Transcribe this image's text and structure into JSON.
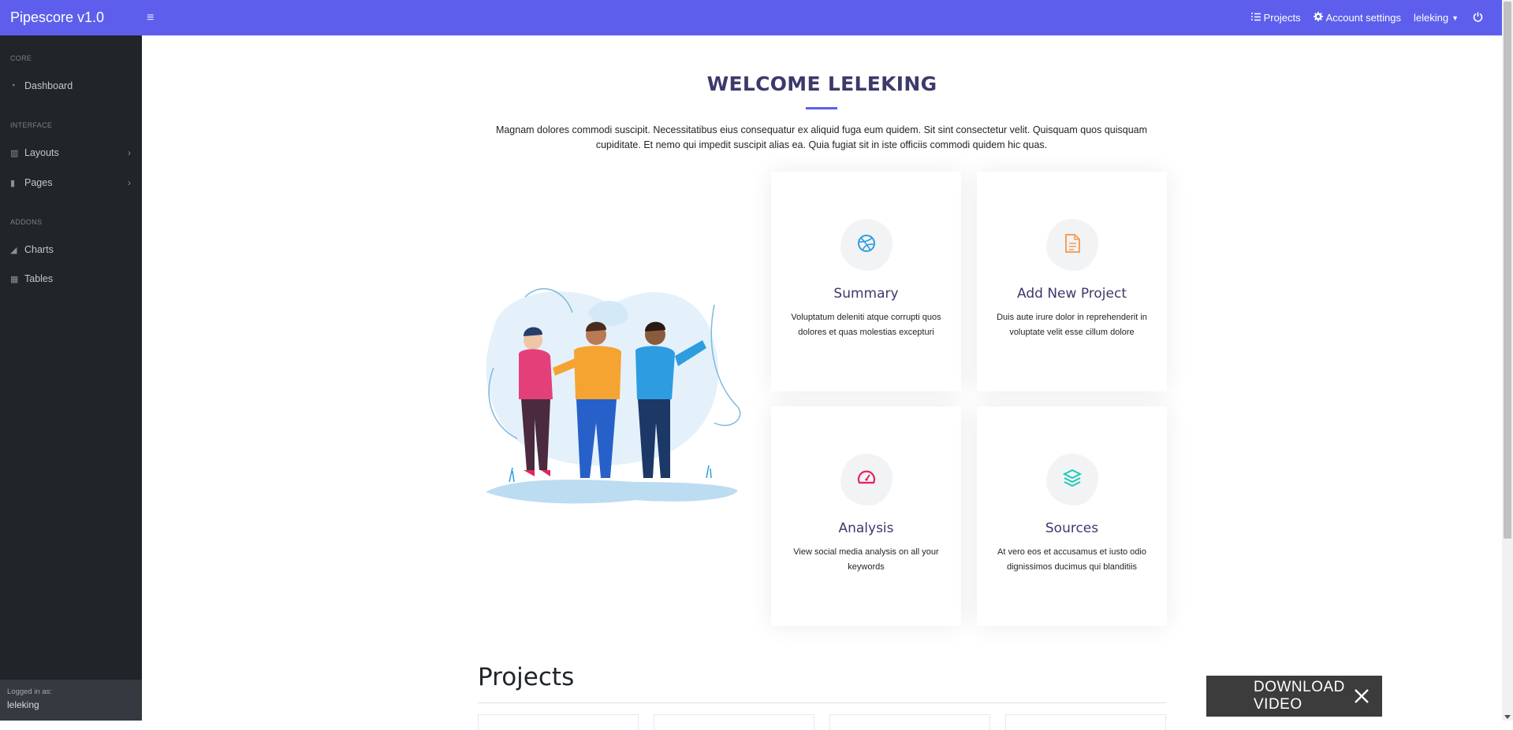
{
  "app": {
    "brand": "Pipescore v1.0"
  },
  "topnav": {
    "projects_label": "Projects",
    "account_label": "Account settings",
    "user_label": "leleking"
  },
  "sidebar": {
    "sections": [
      {
        "heading": "CORE",
        "items": [
          {
            "label": "Dashboard",
            "icon": "dashboard-icon"
          }
        ]
      },
      {
        "heading": "INTERFACE",
        "items": [
          {
            "label": "Layouts",
            "icon": "columns-icon"
          },
          {
            "label": "Pages",
            "icon": "book-icon"
          }
        ]
      },
      {
        "heading": "ADDONS",
        "items": [
          {
            "label": "Charts",
            "icon": "chart-area-icon"
          },
          {
            "label": "Tables",
            "icon": "table-icon"
          }
        ]
      }
    ],
    "footer": {
      "logged_in_label": "Logged in as:",
      "username": "leleking"
    }
  },
  "main": {
    "welcome_title": "WELCOME LELEKING",
    "intro_text": "Magnam dolores commodi suscipit. Necessitatibus eius consequatur ex aliquid fuga eum quidem. Sit sint consectetur velit. Quisquam quos quisquam cupiditate. Et nemo qui impedit suscipit alias ea. Quia fugiat sit in iste officiis commodi quidem hic quas.",
    "cards": [
      {
        "title": "Summary",
        "desc": "Voluptatum deleniti atque corrupti quos dolores et quas molestias excepturi",
        "icon": "dribbble-icon",
        "color": "#2d9de0"
      },
      {
        "title": "Add New Project",
        "desc": "Duis aute irure dolor in reprehenderit in voluptate velit esse cillum dolore",
        "icon": "file-text-icon",
        "color": "#f5a05b"
      },
      {
        "title": "Analysis",
        "desc": "View social media analysis on all your keywords",
        "icon": "speedometer-icon",
        "color": "#e3245f"
      },
      {
        "title": "Sources",
        "desc": "At vero eos et accusamus et iusto odio dignissimos ducimus qui blanditiis",
        "icon": "layers-icon",
        "color": "#1dc9b7"
      }
    ],
    "projects_heading": "Projects"
  },
  "overlay": {
    "download_label": "DOWNLOAD VIDEO"
  },
  "colors": {
    "navbar": "#5d5fec",
    "sidebar": "#212529",
    "heading": "#3c3a6b"
  }
}
